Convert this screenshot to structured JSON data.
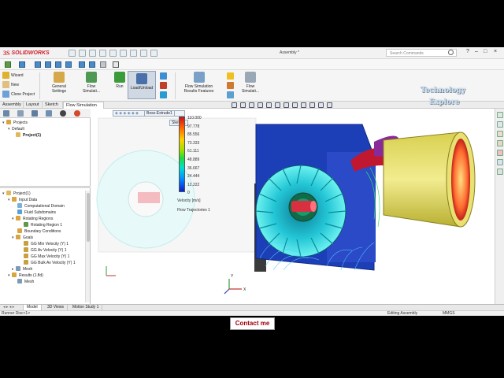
{
  "app": {
    "name": "SOLIDWORKS",
    "doc_title": "Assembly *",
    "search_placeholder": "Search Commands"
  },
  "ribbon": {
    "wizard": "Wizard",
    "new": "New",
    "clone_project": "Clone Project",
    "general_settings": "General Settings",
    "flow_simulation_top": "Flow Simulati...",
    "run": "Run",
    "load_unload": "Load/Unload",
    "results_features": "Flow Simulation Results Features",
    "flow_simulation_right": "Flow Simulati..."
  },
  "tabs": [
    "Assembly",
    "Layout",
    "Sketch",
    "Flow Simulation"
  ],
  "active_tab": "Flow Simulation",
  "top_tree": {
    "projects": "Projects",
    "default": "Default",
    "project1": "Project(1)"
  },
  "tree": {
    "root": "Project(1)",
    "input_data": "Input Data",
    "computational_domain": "Computational Domain",
    "fluid_subdomains": "Fluid Subdomains",
    "rotating_regions": "Rotating Regions",
    "rotating_region_1": "Rotating Region 1",
    "boundary_conditions": "Boundary Conditions",
    "goals": "Goals",
    "goal_1": "GG Min Velocity (Y) 1",
    "goal_2": "GG Av Velocity (Y) 1",
    "goal_3": "GG Max Velocity (Y) 1",
    "goal_4": "GG Bulk Av Velocity (Y) 1",
    "mesh": "Mesh",
    "results": "Results (1.fld)",
    "results_mesh": "Mesh"
  },
  "viewport": {
    "feature_chip": "Boss-Extrude1",
    "sketch_chip": "Sketch1",
    "legend_values": [
      "110.000",
      "97.778",
      "85.556",
      "73.333",
      "61.111",
      "48.889",
      "36.667",
      "24.444",
      "12.222",
      "0"
    ],
    "legend_unit": "Velocity [m/s]",
    "legend_caption": "Flow Trajectories 1",
    "axis_x": "X",
    "axis_y": "Y"
  },
  "bottom_tabs": [
    "Model",
    "3D Views",
    "Motion Study 1"
  ],
  "active_bottom_tab": "Model",
  "status": {
    "left": "Runner Disc<1>",
    "editing": "Editing Assembly",
    "units": "MMGS"
  },
  "watermark": {
    "line1": "Technology",
    "line2": "Explore"
  },
  "contact": "Contact me",
  "colors": {
    "accent_red": "#d01e2a",
    "legend_top": "#d0121b",
    "legend_bottom": "#0a1fd2",
    "fan_cyan": "#2fd8e0",
    "housing_blue": "#1c3fb8"
  }
}
